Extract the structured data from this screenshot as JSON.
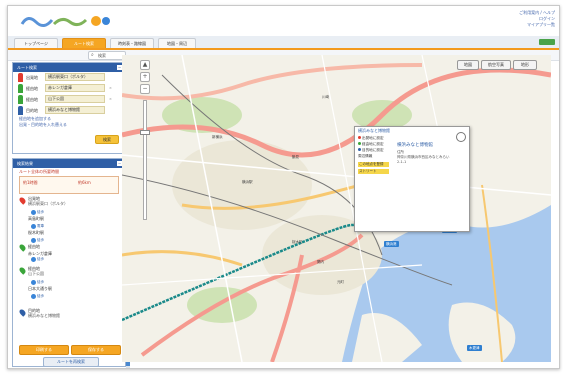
{
  "header": {
    "links": [
      "ご利用案内 / ヘルプ",
      "ログイン",
      "マイアプリ一覧"
    ]
  },
  "tabs": [
    {
      "label": "トップページ",
      "active": false
    },
    {
      "label": "ルート検索",
      "active": true
    },
    {
      "label": "時刻表・路線図",
      "active": false
    },
    {
      "label": "地図・周辺",
      "active": false
    }
  ],
  "toolbar": {
    "search_icon": "search-icon",
    "search_label": "検索"
  },
  "route_panel": {
    "title": "ルート検索",
    "rows": [
      {
        "label": "出発地",
        "value": "横浜駅東口（ポルタ）",
        "pin_color": "#e23b2f"
      },
      {
        "label": "経由地",
        "value": "赤レンガ倉庫",
        "pin_color": "#3aa53a"
      },
      {
        "label": "経由地",
        "value": "山下公園",
        "pin_color": "#3aa53a"
      },
      {
        "label": "目的地",
        "value": "横浜みなと博物館",
        "pin_color": "#2f5fa6"
      }
    ],
    "links": [
      "経由地を追加する",
      "出発・目的地を入れ替える"
    ],
    "search_button": "検索"
  },
  "result_panel": {
    "title": "検索結果",
    "summary_title": "ルート全体の所要時間",
    "summary_a": "約1時間",
    "summary_b": "約6km",
    "steps": [
      {
        "name": "出発地",
        "sub": "横浜駅東口（ポルタ）",
        "chip": "徒歩",
        "color": "#e23b2f"
      },
      {
        "name": "高島町駅",
        "sub": "",
        "chip": "電車",
        "color": "#888888"
      },
      {
        "name": "桜木町駅",
        "sub": "",
        "chip": "徒歩",
        "color": "#888888"
      },
      {
        "name": "経由地",
        "sub": "赤レンガ倉庫",
        "chip": "徒歩",
        "color": "#3aa53a"
      },
      {
        "name": "経由地",
        "sub": "山下公園",
        "chip": "徒歩",
        "color": "#3aa53a"
      },
      {
        "name": "日本大通り駅",
        "sub": "",
        "chip": "徒歩",
        "color": "#888888"
      },
      {
        "name": "目的地",
        "sub": "横浜みなと博物館",
        "chip": "",
        "color": "#2f5fa6"
      }
    ],
    "print_button": "印刷する",
    "save_button": "保存する",
    "research_button": "ルートを再検索"
  },
  "map": {
    "controls": [
      "地図",
      "航空写真",
      "地形"
    ],
    "popup": {
      "header": "横浜みなと博物館",
      "options": [
        "出発地に設定",
        "経由地に設定",
        "目的地に設定",
        "周辺情報"
      ],
      "yellow_1": "この地点を登録",
      "yellow_2": "ストリート",
      "title": "横浜みなと博物館",
      "lines": [
        "住所",
        "神奈川県横浜市西区みなとみらい",
        "2-1-1"
      ]
    },
    "places": [
      "横浜駅",
      "桜木町",
      "関内",
      "元町",
      "新横浜",
      "鶴見",
      "川崎"
    ],
    "blue_labels": [
      "東京湾",
      "横浜港",
      "木更津"
    ]
  }
}
